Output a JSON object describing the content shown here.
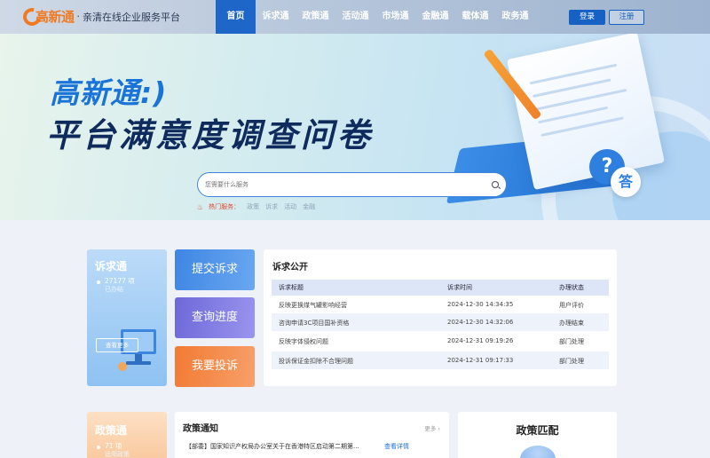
{
  "header": {
    "logo_text": "高新通",
    "slogan": "亲清在线企业服务平台",
    "nav": [
      {
        "label": "首页",
        "active": true
      },
      {
        "label": "诉求通"
      },
      {
        "label": "政策通"
      },
      {
        "label": "活动通"
      },
      {
        "label": "市场通"
      },
      {
        "label": "金融通"
      },
      {
        "label": "载体通"
      },
      {
        "label": "政务通"
      }
    ],
    "login_label": "登录",
    "register_label": "注册"
  },
  "banner": {
    "title_line1": "高新通:)",
    "title_line2": "平台满意度调查问卷",
    "bubble_q": "?",
    "bubble_a": "答",
    "search_placeholder": "您需要什么服务",
    "hot_label": "热门服务：",
    "hot_tags": [
      "政策",
      "诉求",
      "活动",
      "金融"
    ]
  },
  "appeal_card": {
    "title": "诉求通",
    "count": "27177 项",
    "count_sub": "已办结",
    "query_label": "查看更多"
  },
  "actions": [
    "提交诉求",
    "查询进度",
    "我要投诉"
  ],
  "appeal_panel": {
    "title": "诉求公开",
    "columns": [
      "诉求标题",
      "诉求时间",
      "办理状态"
    ],
    "rows": [
      {
        "title": "反映更换煤气罐影响经营",
        "time": "2024-12-30 14:34:35",
        "status": "用户评价"
      },
      {
        "title": "咨询申请3C项目国补资格",
        "time": "2024-12-30 14:32:06",
        "status": "办理结束"
      },
      {
        "title": "反映字体侵权问题",
        "time": "2024-12-31 09:19:26",
        "status": "部门处理"
      },
      {
        "title": "投诉保证金扣除不合理问题",
        "time": "2024-12-31 09:17:33",
        "status": "部门处理"
      }
    ]
  },
  "policy_card": {
    "title": "政策通",
    "count": "71 项",
    "count_sub": "适用政策"
  },
  "policy_panel": {
    "title": "政策通知",
    "more": "更多",
    "notice": "【部委】国家知识产权局办公室关于在香港特区启动第二期第...",
    "notice_link": "查看详情"
  },
  "match_panel": {
    "title": "政策匹配"
  },
  "colors": {
    "primary": "#1e66c8",
    "accent_orange": "#f07a21",
    "action_blue": "#3e86e4",
    "action_purple": "#6d68d8",
    "action_orange": "#f27a33"
  }
}
